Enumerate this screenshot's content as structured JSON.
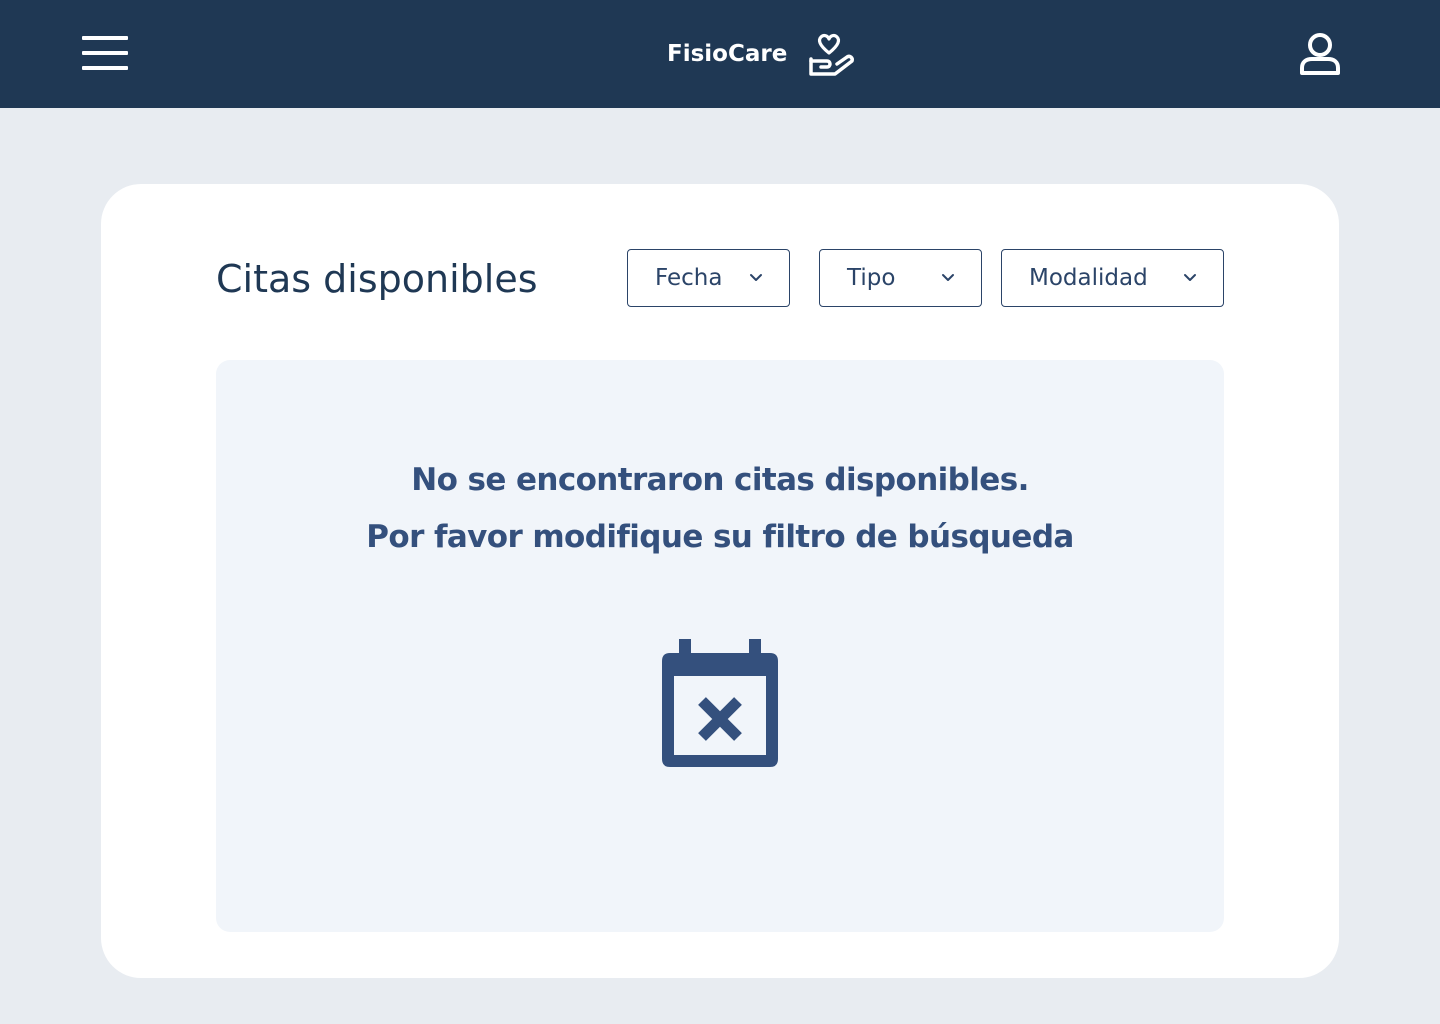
{
  "header": {
    "menu_icon": "hamburger-menu-icon",
    "brand_name": "FisioCare",
    "brand_icon": "hand-holding-heart-icon",
    "user_icon": "user-profile-icon",
    "background_color": "#1f3854"
  },
  "main": {
    "title": "Citas disponibles",
    "filters": [
      {
        "label": "Fecha",
        "icon": "chevron-down-icon"
      },
      {
        "label": "Tipo",
        "icon": "chevron-down-icon"
      },
      {
        "label": "Modalidad",
        "icon": "chevron-down-icon"
      }
    ],
    "empty_state": {
      "line1": "No se encontraron citas disponibles.",
      "line2": "Por favor modifique su filtro de búsqueda",
      "icon": "calendar-x-icon"
    }
  },
  "colors": {
    "navy": "#1f3854",
    "accent_text": "#34507d",
    "page_background": "#e8ecf1",
    "panel_background": "#f1f5fa"
  }
}
